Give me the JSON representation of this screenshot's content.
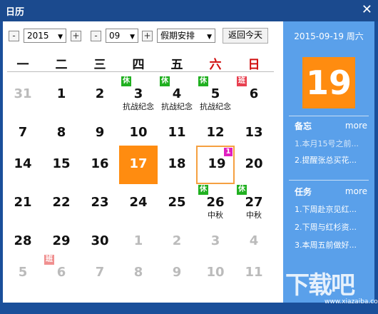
{
  "window": {
    "title": "日历"
  },
  "toolbar": {
    "minus": "-",
    "plus": "+",
    "year": "2015",
    "month": "09",
    "mode": "假期安排",
    "today_button": "返回今天"
  },
  "weekdays": [
    "一",
    "二",
    "三",
    "四",
    "五",
    "六",
    "日"
  ],
  "calendar": {
    "rows": [
      [
        {
          "day": "31",
          "other": true
        },
        {
          "day": "1"
        },
        {
          "day": "2"
        },
        {
          "day": "3",
          "badge": "休",
          "badge_type": "rest",
          "sub": "抗战纪念"
        },
        {
          "day": "4",
          "badge": "休",
          "badge_type": "rest",
          "sub": "抗战纪念"
        },
        {
          "day": "5",
          "badge": "休",
          "badge_type": "rest",
          "sub": "抗战纪念"
        },
        {
          "day": "6",
          "badge": "班",
          "badge_type": "work"
        }
      ],
      [
        {
          "day": "7"
        },
        {
          "day": "8"
        },
        {
          "day": "9"
        },
        {
          "day": "10"
        },
        {
          "day": "11"
        },
        {
          "day": "12"
        },
        {
          "day": "13"
        }
      ],
      [
        {
          "day": "14"
        },
        {
          "day": "15"
        },
        {
          "day": "16"
        },
        {
          "day": "17",
          "today": true
        },
        {
          "day": "18"
        },
        {
          "day": "19",
          "selected": true,
          "memo_count": "1"
        },
        {
          "day": "20"
        }
      ],
      [
        {
          "day": "21"
        },
        {
          "day": "22"
        },
        {
          "day": "23"
        },
        {
          "day": "24"
        },
        {
          "day": "25"
        },
        {
          "day": "26",
          "badge": "休",
          "badge_type": "rest",
          "sub": "中秋"
        },
        {
          "day": "27",
          "badge": "休",
          "badge_type": "rest",
          "sub": "中秋"
        }
      ],
      [
        {
          "day": "28"
        },
        {
          "day": "29"
        },
        {
          "day": "30"
        },
        {
          "day": "1",
          "other": true
        },
        {
          "day": "2",
          "other": true
        },
        {
          "day": "3",
          "other": true
        },
        {
          "day": "4",
          "other": true
        }
      ],
      [
        {
          "day": "5",
          "other": true
        },
        {
          "day": "6",
          "other": true,
          "badge": "班",
          "badge_type": "work"
        },
        {
          "day": "7",
          "other": true
        },
        {
          "day": "8",
          "other": true
        },
        {
          "day": "9",
          "other": true
        },
        {
          "day": "10",
          "other": true
        },
        {
          "day": "11",
          "other": true
        }
      ]
    ]
  },
  "side": {
    "date_text": "2015-09-19 周六",
    "big_day": "19",
    "memo": {
      "title": "备忘",
      "more": "more",
      "items": [
        "1.本月15号之前...",
        "2.提醒张总买花..."
      ]
    },
    "tasks": {
      "title": "任务",
      "more": "more",
      "items": [
        "1.下周赴京见红...",
        "2.下周与红杉资...",
        "3.本周五前做好..."
      ]
    }
  },
  "watermark": {
    "text": "下载吧",
    "sub": "www.xiazaiba.com"
  },
  "colors": {
    "titlebar": "#1b4a8e",
    "side_panel": "#5aa0ea",
    "today": "#ff8c10",
    "rest_badge": "#20b020",
    "work_badge": "#e84050",
    "weekend_header": "#d01010"
  }
}
